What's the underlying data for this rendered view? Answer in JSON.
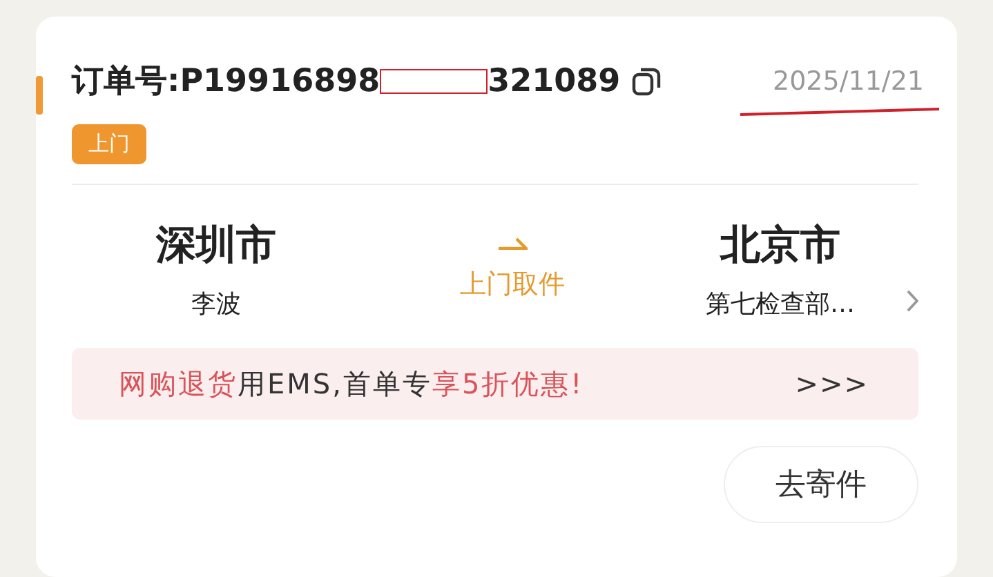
{
  "order": {
    "label_prefix": "订单号:P19916898",
    "label_suffix": "321089",
    "redacted": true,
    "date": "2025/11/21",
    "date_underlined": true,
    "tag": "上门"
  },
  "route": {
    "from_city": "深圳市",
    "from_name": "李波",
    "status": "上门取件",
    "to_city": "北京市",
    "to_name": "第七检查部…"
  },
  "promo": {
    "segments": [
      {
        "text": "网购退货",
        "highlight": true
      },
      {
        "text": "用EMS,首单专",
        "highlight": false
      },
      {
        "text": "享5折优惠!",
        "highlight": true
      }
    ],
    "more": ">>>"
  },
  "buttons": [
    "去寄件"
  ]
}
